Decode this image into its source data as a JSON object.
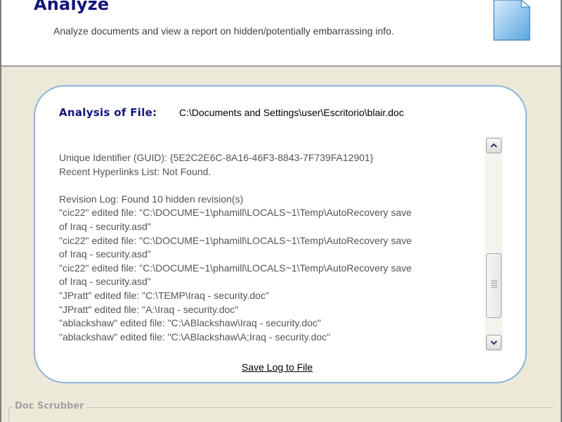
{
  "header": {
    "title": "Analyze",
    "subtitle": "Analyze documents and view a report on hidden/potentially embarrassing info."
  },
  "analysis": {
    "label": "Analysis of File:",
    "file_path": "C:\\Documents and Settings\\user\\Escritorio\\blair.doc"
  },
  "log_lines": [
    "Unique Identifier (GUID): {5E2C2E6C-8A16-46F3-8843-7F739FA12901}",
    "Recent Hyperlinks List: Not Found.",
    "",
    "Revision Log: Found 10 hidden revision(s)",
    "\"cic22\" edited file: \"C:\\DOCUME~1\\phamill\\LOCALS~1\\Temp\\AutoRecovery save",
    "of Iraq - security.asd\"",
    "\"cic22\" edited file: \"C:\\DOCUME~1\\phamill\\LOCALS~1\\Temp\\AutoRecovery save",
    "of Iraq - security.asd\"",
    "\"cic22\" edited file: \"C:\\DOCUME~1\\phamill\\LOCALS~1\\Temp\\AutoRecovery save",
    "of Iraq - security.asd\"",
    "\"JPratt\" edited file: \"C:\\TEMP\\Iraq - security.doc\"",
    "\"JPratt\" edited file: \"A:\\Iraq - security.doc\"",
    "\"ablackshaw\" edited file: \"C:\\ABlackshaw\\Iraq - security.doc\"",
    "\"ablackshaw\" edited file: \"C:\\ABlackshaw\\A;Iraq - security.doc\""
  ],
  "save_log_label": "Save Log to File",
  "group": {
    "label": "Doc Scrubber"
  },
  "icons": {
    "document": "document-icon",
    "scroll_up": "chevron-up-icon",
    "scroll_down": "chevron-down-icon"
  },
  "colors": {
    "title": "#14147a",
    "panel_border": "#8fb3d9",
    "background": "#ece9d8"
  }
}
